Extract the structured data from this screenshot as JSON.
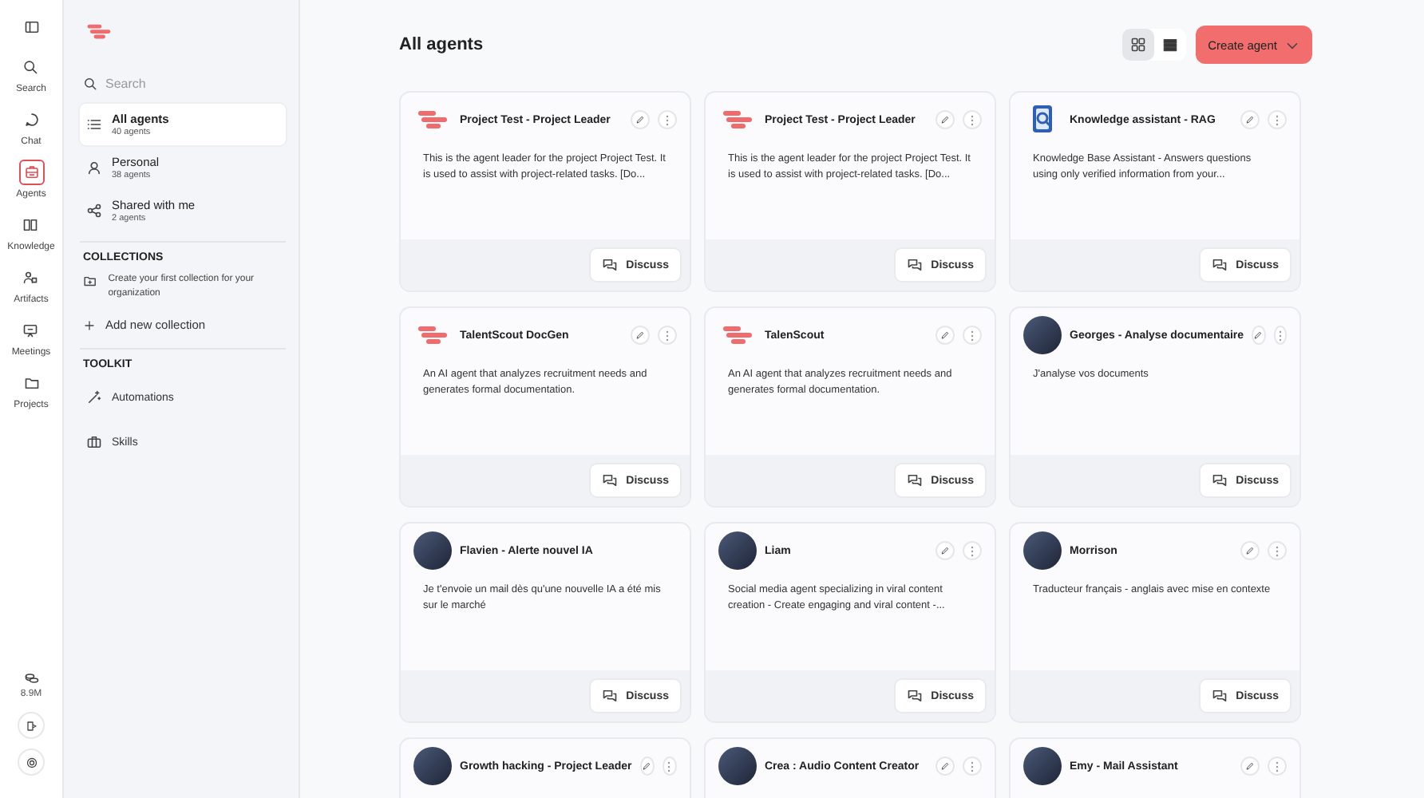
{
  "rail": {
    "items": [
      {
        "label": "Search",
        "selected": false
      },
      {
        "label": "Chat",
        "selected": false
      },
      {
        "label": "Agents",
        "selected": true
      },
      {
        "label": "Knowledge",
        "selected": false
      },
      {
        "label": "Artifacts",
        "selected": false
      },
      {
        "label": "Meetings",
        "selected": false
      },
      {
        "label": "Projects",
        "selected": false
      }
    ],
    "usage": "8.9M"
  },
  "sidebar": {
    "search": {
      "placeholder": "Search"
    },
    "items": [
      {
        "label": "All agents",
        "count": "40 agents",
        "selected": true
      },
      {
        "label": "Personal",
        "count": "38 agents",
        "selected": false
      },
      {
        "label": "Shared with me",
        "count": "2 agents",
        "selected": false
      }
    ],
    "collections": {
      "heading": "COLLECTIONS",
      "empty_text": "Create your first collection for your organization",
      "add": "Add new collection"
    },
    "toolkit": {
      "heading": "TOOLKIT",
      "items": [
        {
          "label": "Automations"
        },
        {
          "label": "Skills"
        }
      ]
    }
  },
  "main": {
    "title": "All agents",
    "views": [
      {
        "kind": "grid",
        "selected": true
      },
      {
        "kind": "list",
        "selected": false
      }
    ],
    "create_button": "Create agent",
    "agents": [
      {
        "name": "Project Test - Project Leader",
        "kind": "logo",
        "actions": true,
        "description": "This is the agent leader for the project Project Test. It is used to assist with project-related tasks. [Do...",
        "discuss": "Discuss"
      },
      {
        "name": "Project Test - Project Leader",
        "kind": "logo",
        "actions": true,
        "description": "This is the agent leader for the project Project Test. It is used to assist with project-related tasks. [Do...",
        "discuss": "Discuss"
      },
      {
        "name": "Knowledge assistant - RAG",
        "kind": "document",
        "actions": true,
        "description": "Knowledge Base Assistant - Answers questions using only verified information from your...",
        "discuss": "Discuss"
      },
      {
        "name": "TalentScout DocGen",
        "kind": "logo",
        "actions": true,
        "description": "An AI agent that analyzes recruitment needs and generates formal documentation.",
        "discuss": "Discuss"
      },
      {
        "name": "TalenScout",
        "kind": "logo",
        "actions": true,
        "description": "An AI agent that analyzes recruitment needs and generates formal documentation.",
        "discuss": "Discuss"
      },
      {
        "name": "Georges - Analyse documentaire",
        "kind": "photo",
        "actions": true,
        "description": "J'analyse vos documents",
        "discuss": "Discuss"
      },
      {
        "name": "Flavien - Alerte nouvel IA",
        "kind": "photo",
        "actions": false,
        "description": "Je t'envoie un mail dès qu'une nouvelle IA a été mis sur le marché",
        "discuss": "Discuss"
      },
      {
        "name": "Liam",
        "kind": "photo",
        "actions": true,
        "description": "Social media agent specializing in viral content creation - Create engaging and viral content -...",
        "discuss": "Discuss"
      },
      {
        "name": "Morrison",
        "kind": "photo",
        "actions": true,
        "description": "Traducteur français - anglais avec mise en contexte",
        "discuss": "Discuss"
      },
      {
        "name": "Growth hacking - Project Leader",
        "kind": "photo",
        "actions": true
      },
      {
        "name": "Crea : Audio Content Creator",
        "kind": "photo",
        "actions": true
      },
      {
        "name": "Emy - Mail Assistant",
        "kind": "photo",
        "actions": true
      }
    ]
  }
}
